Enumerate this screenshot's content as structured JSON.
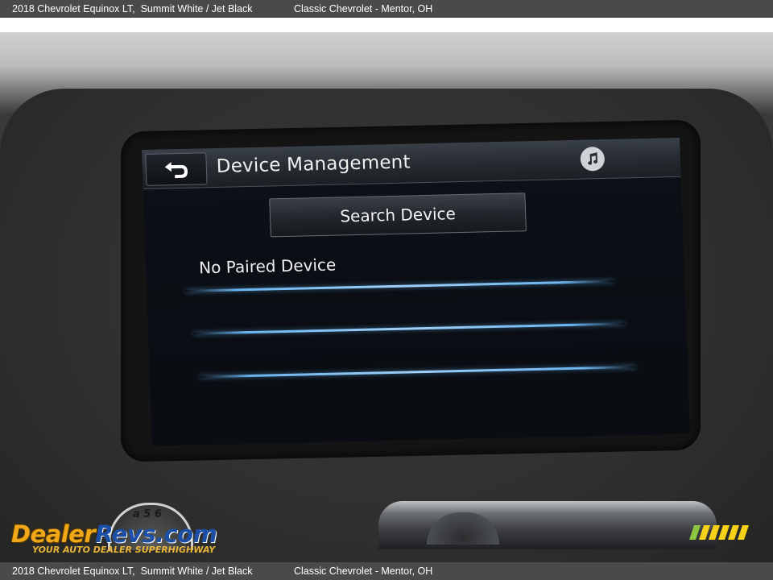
{
  "caption": {
    "vehicle": "2018 Chevrolet Equinox LT,  Summit White / Jet Black",
    "dealer": "Classic Chevrolet - Mentor, OH"
  },
  "screen": {
    "title": "Device Management",
    "back_icon": "back-arrow-icon",
    "music_icon": "music-note-icon",
    "search_button_label": "Search Device",
    "status": "No Paired Device",
    "list_line_color": "#6ab4ef"
  },
  "watermark": {
    "brand_part1": "Dealer",
    "brand_part2": "Revs",
    "brand_suffix": ".com",
    "tagline": "YOUR AUTO DEALER SUPERHIGHWAY",
    "gauge_digits": "a 5 6",
    "primary_color": "#f0a818",
    "secondary_color": "#1c4fa8"
  }
}
